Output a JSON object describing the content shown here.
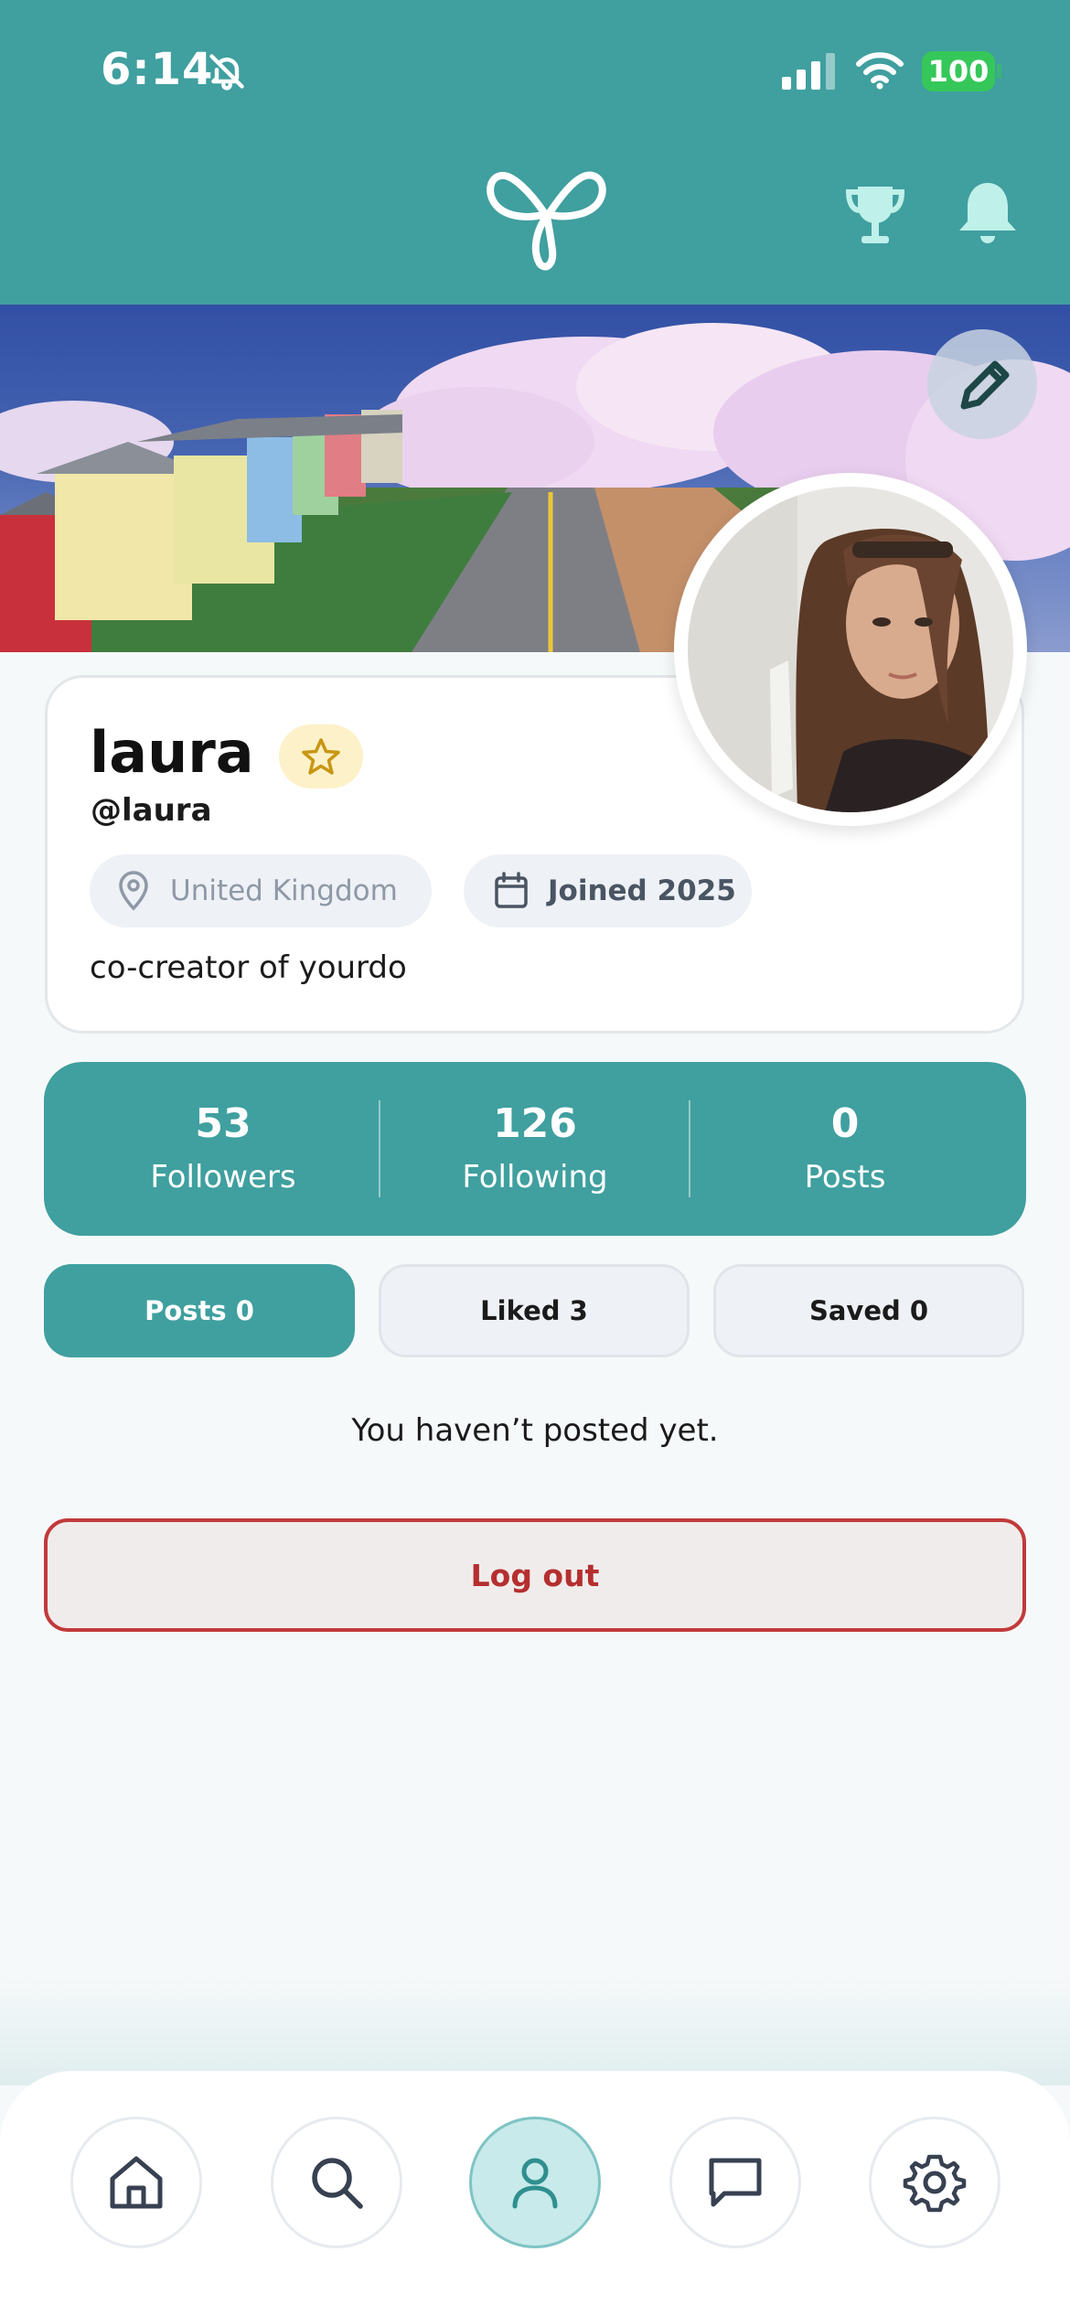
{
  "status_bar": {
    "time": "6:14",
    "battery": "100"
  },
  "profile": {
    "name": "laura",
    "handle": "@laura",
    "location": "United Kingdom",
    "joined": "Joined 2025",
    "bio": "co-creator of yourdo"
  },
  "stats": [
    {
      "value": "53",
      "label": "Followers"
    },
    {
      "value": "126",
      "label": "Following"
    },
    {
      "value": "0",
      "label": "Posts"
    }
  ],
  "tabs": [
    {
      "label": "Posts 0",
      "active": true
    },
    {
      "label": "Liked 3",
      "active": false
    },
    {
      "label": "Saved 0",
      "active": false
    }
  ],
  "empty_message": "You haven’t posted yet.",
  "logout_label": "Log out",
  "nav": {
    "items": [
      "home-icon",
      "search-icon",
      "profile-icon",
      "chat-icon",
      "settings-icon"
    ],
    "active": "profile-icon"
  },
  "colors": {
    "brand_teal": "#409f9f",
    "logout_red": "#c13a3a",
    "badge_yellow": "#fdf1c9",
    "battery_green": "#35c759"
  }
}
